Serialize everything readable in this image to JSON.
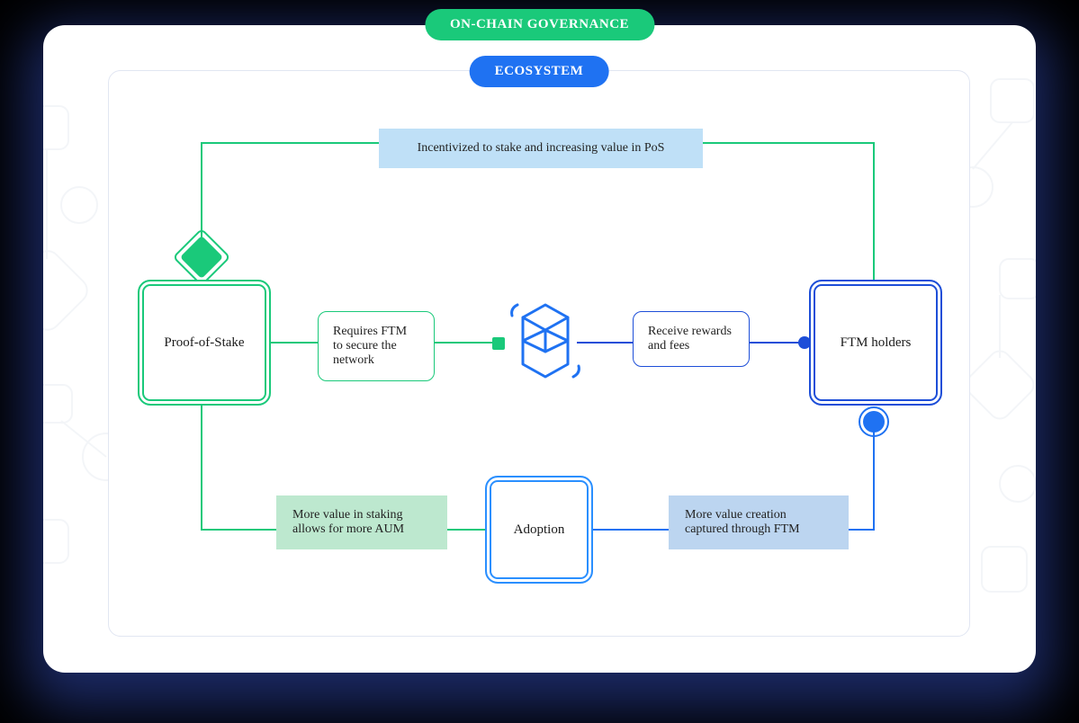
{
  "header": {
    "governance_label": "ON-CHAIN GOVERNANCE",
    "ecosystem_label": "ECOSYSTEM"
  },
  "nodes": {
    "pos": "Proof-of-Stake",
    "ftm_holders": "FTM holders",
    "adoption": "Adoption"
  },
  "notes": {
    "requires": "Requires FTM to secure the network",
    "receive": "Receive rewards and fees"
  },
  "labels": {
    "top": "Incentivized to stake and increasing value in PoS",
    "green": "More value in staking allows for more AUM",
    "blue": "More value creation captured through FTM"
  },
  "colors": {
    "green": "#1ac97a",
    "blue": "#1f72f2",
    "darkblue": "#1d4ed8",
    "lightblue": "#2a8fff"
  }
}
